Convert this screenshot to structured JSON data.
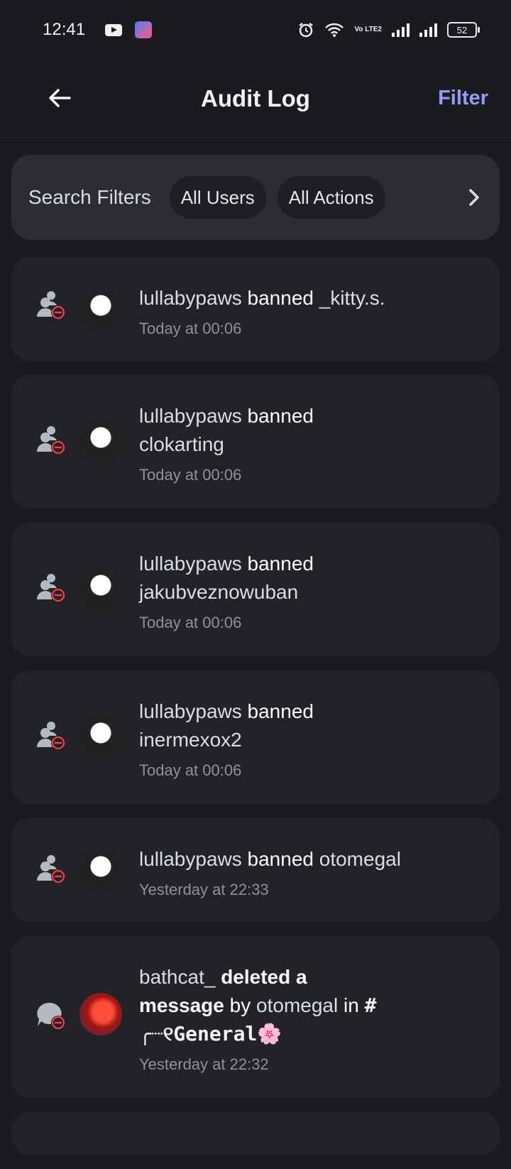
{
  "status_bar": {
    "time": "12:41",
    "volte": "Vo LTE2",
    "battery": "52"
  },
  "header": {
    "title": "Audit Log",
    "filter_label": "Filter"
  },
  "search_filters": {
    "label": "Search Filters",
    "chips": [
      "All Users",
      "All Actions"
    ]
  },
  "entries": [
    {
      "actor": "lullabypaws",
      "verb": "banned",
      "target": "_kitty.s.",
      "time": "Today at 00:06"
    },
    {
      "actor": "lullabypaws",
      "verb": "banned",
      "target": "clokarting",
      "time": "Today at 00:06"
    },
    {
      "actor": "lullabypaws",
      "verb": "banned",
      "target": "jakubveznowuban",
      "time": "Today at 00:06"
    },
    {
      "actor": "lullabypaws",
      "verb": "banned",
      "target": "inermexox2",
      "time": "Today at 00:06"
    },
    {
      "actor": "lullabypaws",
      "verb": "banned",
      "target": "otomegal",
      "time": "Yesterday at 22:33"
    },
    {
      "actor": "bathcat_",
      "verb": "deleted a",
      "object": "message",
      "by": "by",
      "target": "otomegal",
      "in": "in",
      "channel": "# ╭┈୧General🌸",
      "time": "Yesterday at 22:32"
    }
  ],
  "colors": {
    "accent": "#949cf7",
    "danger": "#f23f43",
    "background": "#1a1b1f",
    "card": "#222328"
  }
}
